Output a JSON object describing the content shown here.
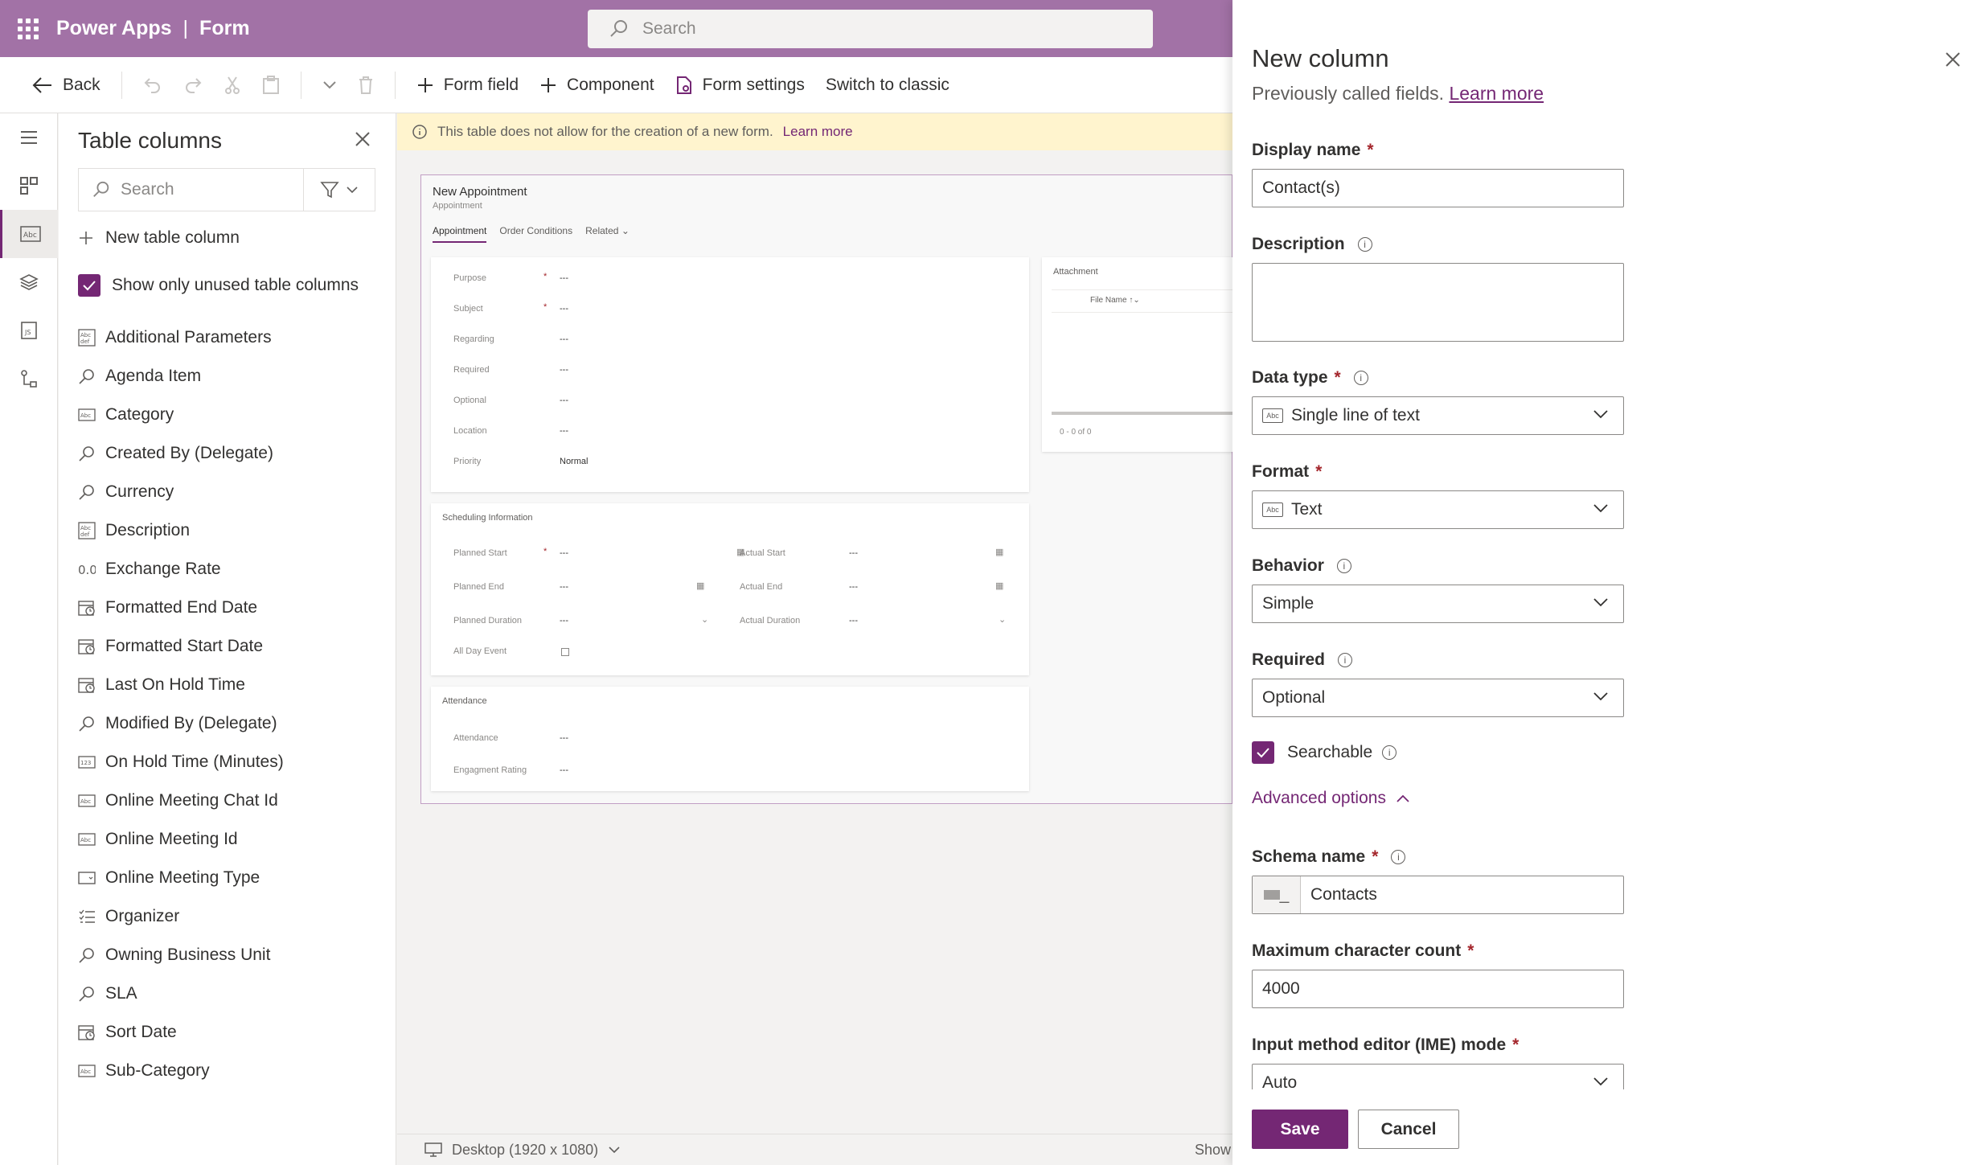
{
  "header": {
    "app_name": "Power Apps",
    "separator": "|",
    "page_name": "Form",
    "search_placeholder": "Search"
  },
  "commandbar": {
    "back": "Back",
    "form_field": "Form field",
    "component": "Component",
    "form_settings": "Form settings",
    "switch_classic": "Switch to classic"
  },
  "columns_panel": {
    "title": "Table columns",
    "search_placeholder": "Search",
    "new_column": "New table column",
    "show_unused": "Show only unused table columns",
    "show_unused_checked": true,
    "items": [
      {
        "label": "Additional Parameters",
        "icon": "multiline-text-icon"
      },
      {
        "label": "Agenda Item",
        "icon": "lookup-icon"
      },
      {
        "label": "Category",
        "icon": "text-icon"
      },
      {
        "label": "Created By (Delegate)",
        "icon": "lookup-icon"
      },
      {
        "label": "Currency",
        "icon": "lookup-icon"
      },
      {
        "label": "Description",
        "icon": "multiline-text-icon"
      },
      {
        "label": "Exchange Rate",
        "icon": "decimal-icon"
      },
      {
        "label": "Formatted End Date",
        "icon": "datetime-icon"
      },
      {
        "label": "Formatted Start Date",
        "icon": "datetime-icon"
      },
      {
        "label": "Last On Hold Time",
        "icon": "datetime-icon"
      },
      {
        "label": "Modified By (Delegate)",
        "icon": "lookup-icon"
      },
      {
        "label": "On Hold Time (Minutes)",
        "icon": "whole-number-icon"
      },
      {
        "label": "Online Meeting Chat Id",
        "icon": "text-icon"
      },
      {
        "label": "Online Meeting Id",
        "icon": "text-icon"
      },
      {
        "label": "Online Meeting Type",
        "icon": "choice-icon"
      },
      {
        "label": "Organizer",
        "icon": "party-list-icon"
      },
      {
        "label": "Owning Business Unit",
        "icon": "lookup-icon"
      },
      {
        "label": "SLA",
        "icon": "lookup-icon"
      },
      {
        "label": "Sort Date",
        "icon": "datetime-icon"
      },
      {
        "label": "Sub-Category",
        "icon": "text-icon"
      }
    ]
  },
  "canvas": {
    "info_text": "This table does not allow for the creation of a new form.",
    "info_link": "Learn more",
    "form_title": "New Appointment",
    "form_subtitle": "Appointment",
    "tabs": [
      "Appointment",
      "Order Conditions",
      "Related"
    ],
    "general_fields": [
      {
        "label": "Purpose",
        "value": "---",
        "required": true
      },
      {
        "label": "Subject",
        "value": "---",
        "required": true
      },
      {
        "label": "Regarding",
        "value": "---"
      },
      {
        "label": "Required",
        "value": "---"
      },
      {
        "label": "Optional",
        "value": "---"
      },
      {
        "label": "Location",
        "value": "---"
      },
      {
        "label": "Priority",
        "value": "Normal"
      }
    ],
    "attachment": {
      "title": "Attachment",
      "column": "File Name",
      "paging": "0 - 0 of 0"
    },
    "scheduling": {
      "title": "Scheduling Information",
      "planned_start": "Planned Start",
      "actual_start": "Actual Start",
      "planned_end": "Planned End",
      "actual_end": "Actual End",
      "planned_duration": "Planned Duration",
      "actual_duration": "Actual Duration",
      "all_day": "All Day Event",
      "dash": "---"
    },
    "attendance": {
      "title": "Attendance",
      "attendance": "Attendance",
      "engagement": "Engagment Rating",
      "dash": "---"
    },
    "status_device": "Desktop (1920 x 1080)",
    "status_show": "Show"
  },
  "new_column": {
    "title": "New column",
    "subtitle": "Previously called fields.",
    "subtitle_link": "Learn more",
    "display_name_label": "Display name",
    "display_name_value": "Contact(s)",
    "description_label": "Description",
    "description_value": "",
    "data_type_label": "Data type",
    "data_type_value": "Single line of text",
    "format_label": "Format",
    "format_value": "Text",
    "behavior_label": "Behavior",
    "behavior_value": "Simple",
    "required_label": "Required",
    "required_value": "Optional",
    "searchable_label": "Searchable",
    "searchable_checked": true,
    "advanced_label": "Advanced options",
    "schema_label": "Schema name",
    "schema_value": "Contacts",
    "max_chars_label": "Maximum character count",
    "max_chars_value": "4000",
    "ime_label": "Input method editor (IME) mode",
    "ime_value": "Auto",
    "save": "Save",
    "cancel": "Cancel"
  },
  "colors": {
    "brand": "#742774",
    "header": "#a272a6",
    "info_bar": "#fff4ce"
  }
}
